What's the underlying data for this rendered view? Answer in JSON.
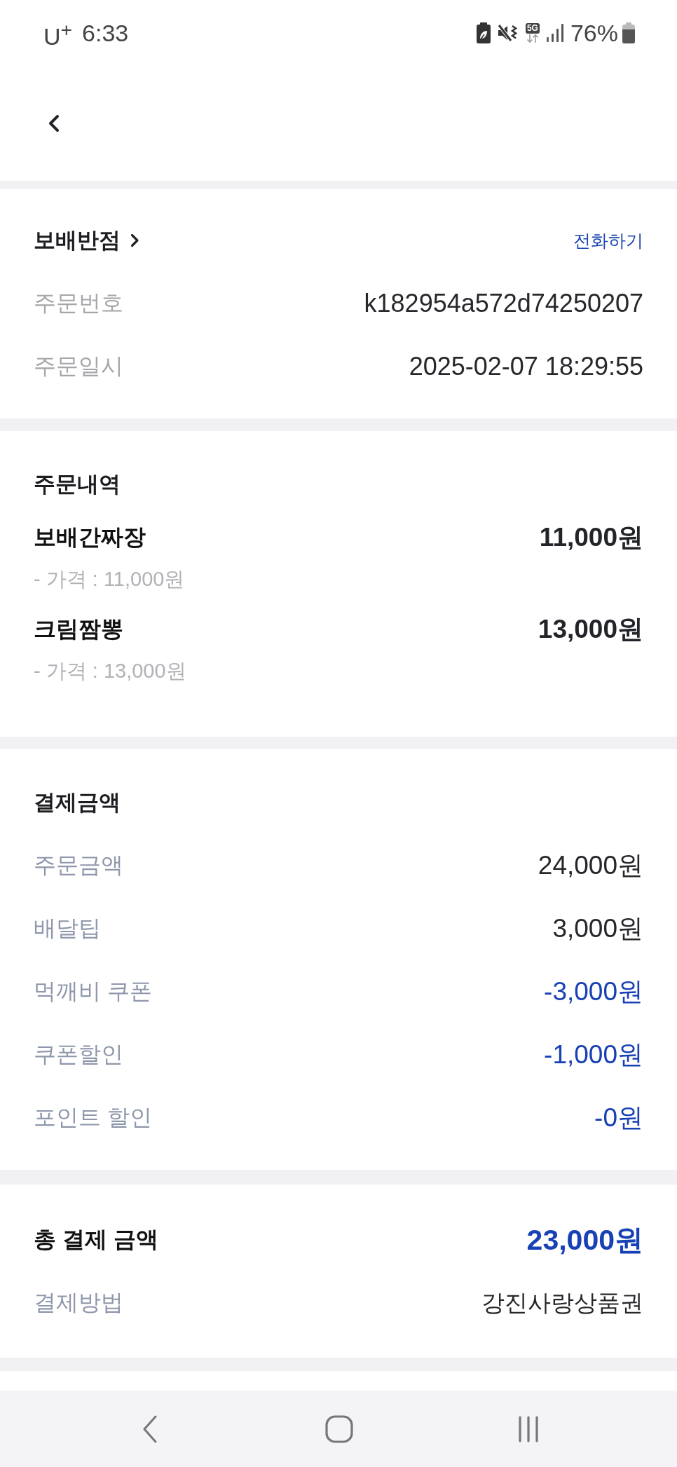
{
  "status_bar": {
    "carrier": "U$^{+}$",
    "time": "6:33",
    "network_type": "5G",
    "battery_percent": "76%"
  },
  "store": {
    "name": "보배반점",
    "call_link": "전화하기",
    "details": [
      {
        "label": "주문번호",
        "value": "k182954a572d74250207"
      },
      {
        "label": "주문일시",
        "value": "2025-02-07 18:29:55"
      }
    ]
  },
  "order_items": {
    "title": "주문내역",
    "items": [
      {
        "name": "보배간짜장",
        "amount": "11,000원",
        "price_line": "- 가격 : 11,000원"
      },
      {
        "name": "크림짬뽕",
        "amount": "13,000원",
        "price_line": "- 가격 : 13,000원"
      }
    ]
  },
  "payment": {
    "title": "결제금액",
    "rows": [
      {
        "label": "주문금액",
        "value": "24,000원",
        "kind": "charge"
      },
      {
        "label": "배달팁",
        "value": "3,000원",
        "kind": "charge"
      },
      {
        "label": "먹깨비 쿠폰",
        "value": "-3,000원",
        "kind": "discount"
      },
      {
        "label": "쿠폰할인",
        "value": "-1,000원",
        "kind": "discount"
      },
      {
        "label": "포인트 할인",
        "value": "-0원",
        "kind": "discount"
      }
    ]
  },
  "total": {
    "label": "총 결제 금액",
    "value": "23,000원",
    "method_label": "결제방법",
    "method_value": "강진사랑상품권"
  }
}
